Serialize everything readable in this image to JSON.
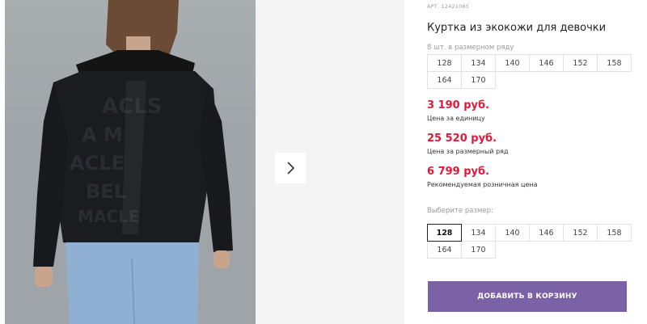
{
  "product": {
    "sku": "АРТ. 12421065",
    "title": "Куртка из экокожи для девочки",
    "pack_note": "8 шт. в размерном ряду",
    "pack_sizes": [
      "128",
      "134",
      "140",
      "146",
      "152",
      "158",
      "164",
      "170"
    ]
  },
  "prices": [
    {
      "value": "3 190 руб.",
      "label": "Цена за единицу"
    },
    {
      "value": "25 520 руб.",
      "label": "Цена за размерный ряд"
    },
    {
      "value": "6 799 руб.",
      "label": "Рекомендуемая розничная цена"
    }
  ],
  "size_select": {
    "label": "Выберите размер:",
    "options": [
      "128",
      "134",
      "140",
      "146",
      "152",
      "158",
      "164",
      "170"
    ],
    "selected": "128"
  },
  "cart": {
    "add_label": "ДОБАВИТЬ В КОРЗИНУ"
  },
  "gallery": {
    "next_icon": "chevron-right-icon"
  },
  "colors": {
    "price": "#e0193a",
    "accent_button": "#7b62a6"
  }
}
